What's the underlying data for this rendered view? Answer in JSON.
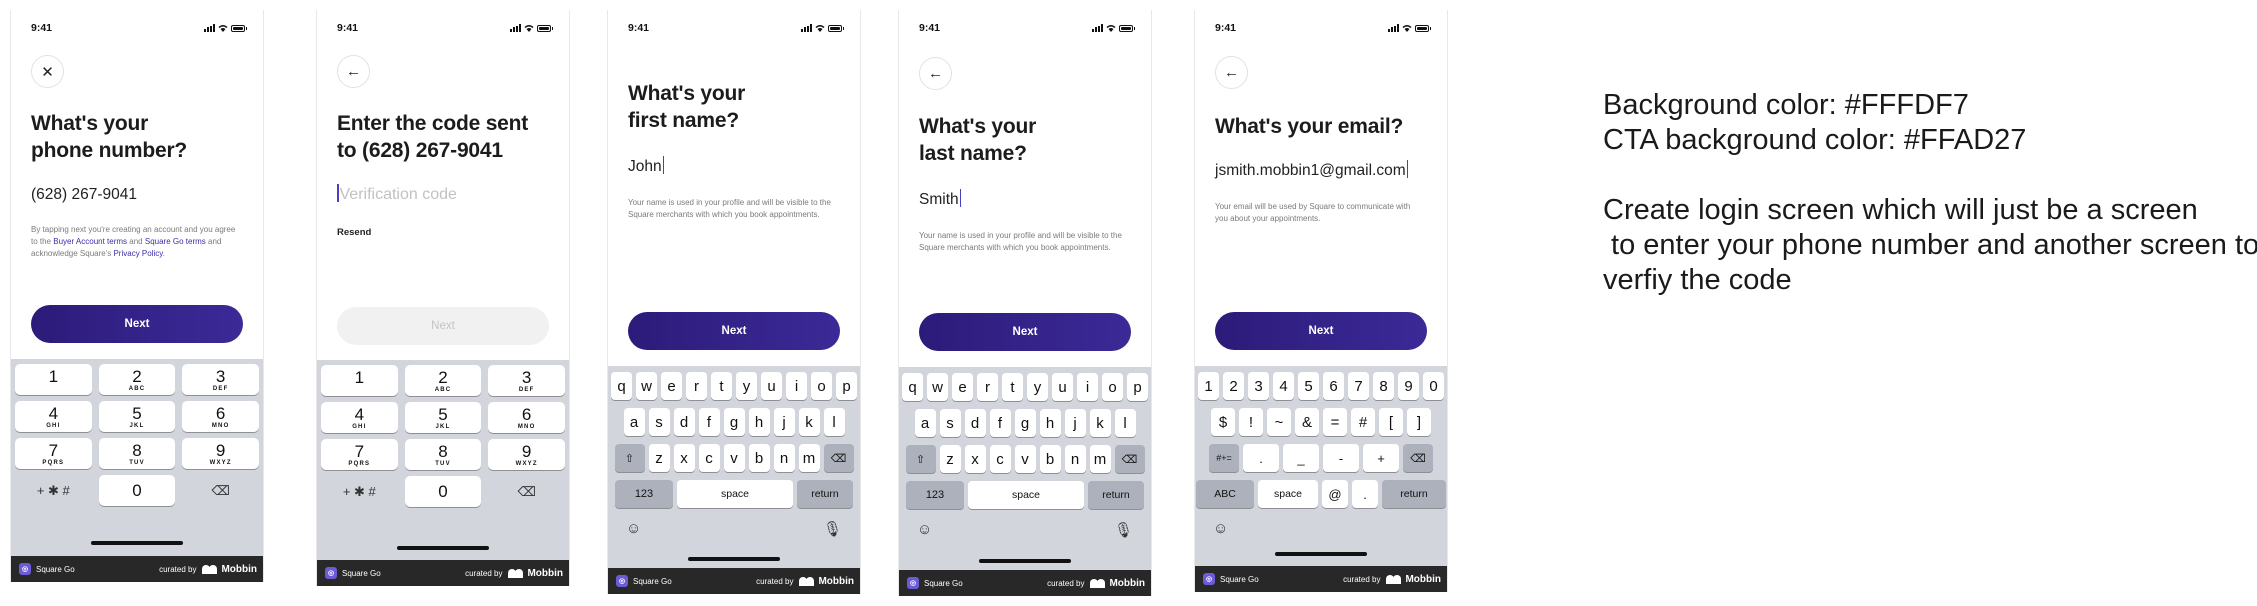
{
  "status_time": "9:41",
  "footer": {
    "app_name": "Square Go",
    "curated_by": "curated by",
    "brand": "Mobbin"
  },
  "screens": [
    {
      "title": "What's your phone number?",
      "value": "(628) 267-9041",
      "helper_parts": [
        "By tapping next you're creating an account and you agree to the ",
        "Buyer Account terms",
        " and ",
        "Square Go terms",
        " and acknowledge Square's ",
        "Privacy Policy",
        "."
      ],
      "cta": "Next"
    },
    {
      "title": "Enter the code sent to (628) 267-9041",
      "placeholder": "Verification code",
      "resend": "Resend",
      "cta": "Next"
    },
    {
      "title": "What's your first name?",
      "value": "John",
      "helper": "Your name is used in your profile and will be visible to the Square merchants with which you book appointments.",
      "cta": "Next"
    },
    {
      "title": "What's your last name?",
      "value": "Smith",
      "helper": "Your name is used in your profile and will be visible to the Square merchants with which you book appointments.",
      "cta": "Next"
    },
    {
      "title": "What's your email?",
      "value": "jsmith.mobbin1@gmail.com",
      "helper": "Your email will be used by Square to communicate with you about your appointments.",
      "cta": "Next"
    }
  ],
  "numpad": {
    "keys": [
      {
        "d": "1",
        "l": ""
      },
      {
        "d": "2",
        "l": "ABC"
      },
      {
        "d": "3",
        "l": "DEF"
      },
      {
        "d": "4",
        "l": "GHI"
      },
      {
        "d": "5",
        "l": "JKL"
      },
      {
        "d": "6",
        "l": "MNO"
      },
      {
        "d": "7",
        "l": "PQRS"
      },
      {
        "d": "8",
        "l": "TUV"
      },
      {
        "d": "9",
        "l": "WXYZ"
      }
    ],
    "symbols": "+ ✱ #",
    "zero": "0",
    "delete_icon": "⌫"
  },
  "qwerty": {
    "row1": [
      "q",
      "w",
      "e",
      "r",
      "t",
      "y",
      "u",
      "i",
      "o",
      "p"
    ],
    "row2": [
      "a",
      "s",
      "d",
      "f",
      "g",
      "h",
      "j",
      "k",
      "l"
    ],
    "row3": [
      "z",
      "x",
      "c",
      "v",
      "b",
      "n",
      "m"
    ],
    "shift_icon": "⇧",
    "delete_icon": "⌫",
    "numbers_key": "123",
    "space_key": "space",
    "return_key": "return",
    "emoji_icon": "☺",
    "mic_icon": "🎙"
  },
  "email_kbd": {
    "row1": [
      "1",
      "2",
      "3",
      "4",
      "5",
      "6",
      "7",
      "8",
      "9",
      "0"
    ],
    "row2": [
      "$",
      "!",
      "~",
      "&",
      "=",
      "#",
      "[",
      "]"
    ],
    "row3": [
      ".",
      "_",
      "-",
      "+"
    ],
    "symbols_key": "#+=",
    "abc_key": "ABC",
    "space_key": "space",
    "at_key": "@",
    "dot_key": ".",
    "return_key": "return",
    "delete_icon": "⌫",
    "emoji_icon": "☺"
  },
  "notes": {
    "line1": "Background color: #FFFDF7",
    "line2": "CTA background color: #FFAD27",
    "line3": "Create login screen which will just be a screen",
    "line4": " to enter your phone number and another screen to",
    "line5": "verfiy the code"
  }
}
